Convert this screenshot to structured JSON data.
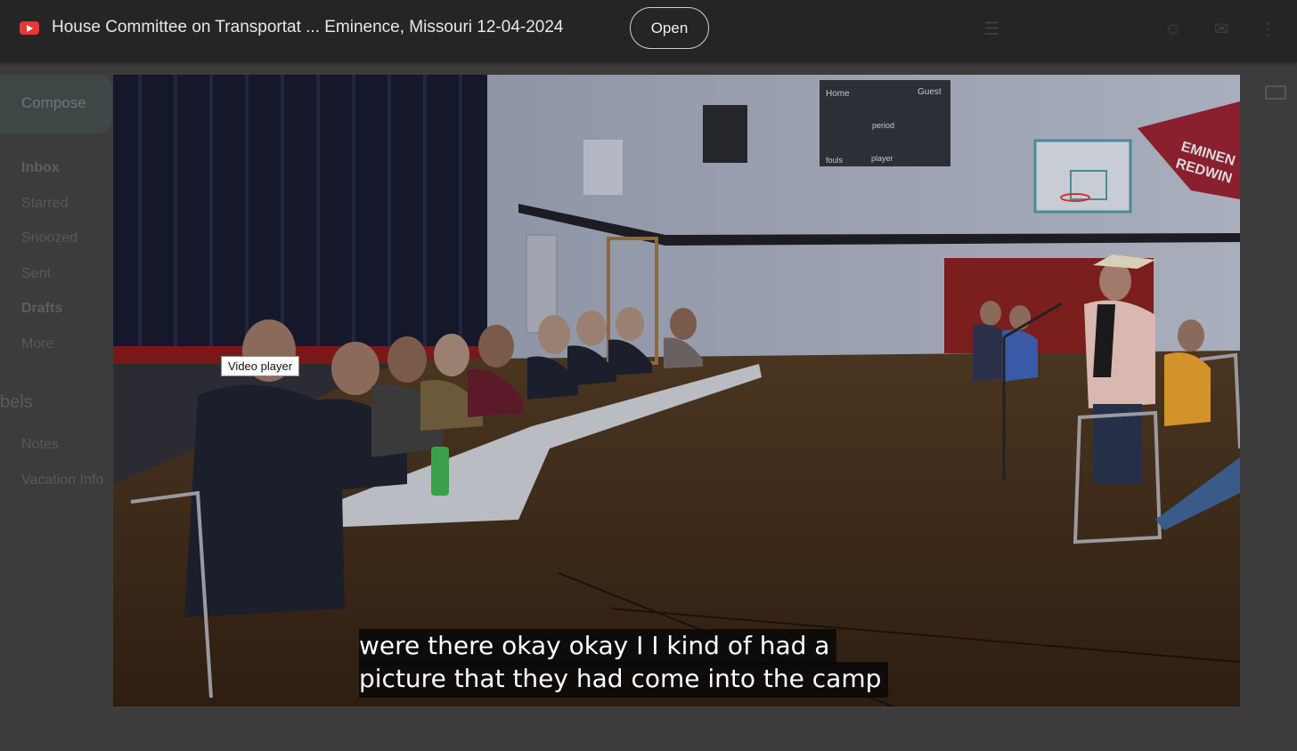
{
  "gmail_background": {
    "compose_label": "Compose",
    "nav_items": [
      {
        "label": "Inbox",
        "bold": true
      },
      {
        "label": "Starred",
        "bold": false
      },
      {
        "label": "Snoozed",
        "bold": false
      },
      {
        "label": "Sent",
        "bold": false
      },
      {
        "label": "Drafts",
        "bold": true
      },
      {
        "label": "More",
        "bold": false
      }
    ],
    "labels_heading": "bels",
    "label_items": [
      "Notes",
      "Vacation Info"
    ]
  },
  "topbar": {
    "app_icon": "youtube-icon",
    "title": "House Committee on Transportat ... Eminence, Missouri 12-04-2024",
    "open_label": "Open",
    "right_icons": [
      "list-icon",
      "emoji-icon",
      "mail-icon",
      "more-icon"
    ]
  },
  "video": {
    "tooltip": "Video player",
    "caption_line1": "were there okay okay I I kind of had a",
    "caption_line2": "picture that they had come into the camp",
    "banner_text_1": "EMINEN",
    "banner_text_2": "REDWIN",
    "scoreboard_home": "Home",
    "scoreboard_guest": "Guest",
    "scoreboard_period": "period",
    "scoreboard_fouls": "fouls",
    "scoreboard_player": "player"
  },
  "colors": {
    "topbar_bg": "#252525",
    "youtube_red": "#e53935",
    "caption_bg": "#080808"
  }
}
